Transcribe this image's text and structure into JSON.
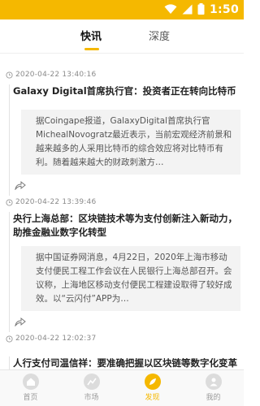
{
  "status_bar": {
    "time": "1:50",
    "icons": [
      "wifi-icon",
      "signal-icon",
      "battery-icon"
    ],
    "color": "#f5b800"
  },
  "tabs": [
    {
      "label": "快讯",
      "active": true
    },
    {
      "label": "深度",
      "active": false
    }
  ],
  "feed": [
    {
      "timestamp": "2020-04-22 13:40:16",
      "title": "Galaxy Digital首席执行官：投资者正在转向比特币",
      "summary": "据Coingape报道，GalaxyDigital首席执行官MichealNovogratz最近表示，当前宏观经济前景和越来越多的人采用比特币的综合效应将对比特币有利。随着越来越大的财政刺激方…"
    },
    {
      "timestamp": "2020-04-22 13:39:46",
      "title": "央行上海总部：区块链技术等为支付创新注入新动力，助推金融业数字化转型",
      "summary": "据中国证券网消息，4月22日，2020年上海市移动支付便民工程工作会议在人民银行上海总部召开。会议称，上海地区移动支付便民工程建设取得了较好成效。以“云闪付”APP为…"
    },
    {
      "timestamp": "2020-04-22 12:02:37",
      "title": "人行支付司温信祥：要准确把握以区块链等数字化变革的巨大影响",
      "summary": ""
    }
  ],
  "bottom_nav": [
    {
      "label": "首页",
      "icon": "home-icon",
      "active": false
    },
    {
      "label": "市场",
      "icon": "market-icon",
      "active": false
    },
    {
      "label": "发现",
      "icon": "discover-icon",
      "active": true
    },
    {
      "label": "我的",
      "icon": "profile-icon",
      "active": false
    }
  ]
}
